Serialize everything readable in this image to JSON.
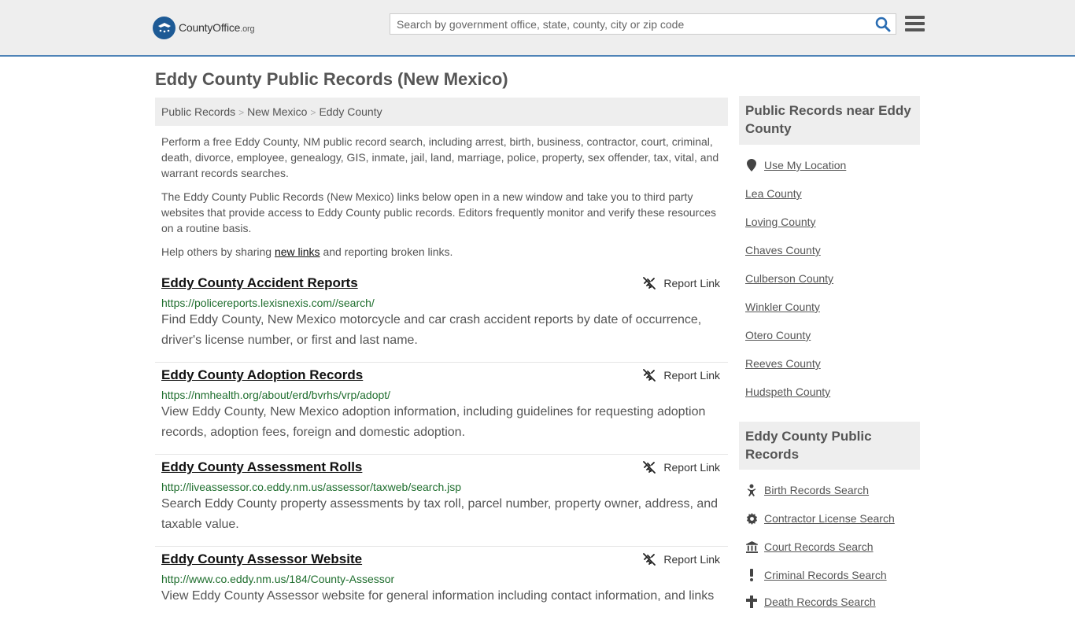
{
  "header": {
    "logo_main": "CountyOffice",
    "logo_org": ".org",
    "search_placeholder": "Search by government office, state, county, city or zip code"
  },
  "page_title": "Eddy County Public Records (New Mexico)",
  "breadcrumb": [
    "Public Records",
    "New Mexico",
    "Eddy County"
  ],
  "intro": {
    "p1": "Perform a free Eddy County, NM public record search, including arrest, birth, business, contractor, court, criminal, death, divorce, employee, genealogy, GIS, inmate, jail, land, marriage, police, property, sex offender, tax, vital, and warrant records searches.",
    "p2": "The Eddy County Public Records (New Mexico) links below open in a new window and take you to third party websites that provide access to Eddy County public records. Editors frequently monitor and verify these resources on a routine basis.",
    "p3_before": "Help others by sharing ",
    "p3_link": "new links",
    "p3_after": " and reporting broken links."
  },
  "report_label": "Report Link",
  "records": [
    {
      "title": "Eddy County Accident Reports",
      "url": "https://policereports.lexisnexis.com//search/",
      "desc": "Find Eddy County, New Mexico motorcycle and car crash accident reports by date of occurrence, driver's license number, or first and last name."
    },
    {
      "title": "Eddy County Adoption Records",
      "url": "https://nmhealth.org/about/erd/bvrhs/vrp/adopt/",
      "desc": "View Eddy County, New Mexico adoption information, including guidelines for requesting adoption records, adoption fees, foreign and domestic adoption."
    },
    {
      "title": "Eddy County Assessment Rolls",
      "url": "http://liveassessor.co.eddy.nm.us/assessor/taxweb/search.jsp",
      "desc": "Search Eddy County property assessments by tax roll, parcel number, property owner, address, and taxable value."
    },
    {
      "title": "Eddy County Assessor Website",
      "url": "http://www.co.eddy.nm.us/184/County-Assessor",
      "desc": "View Eddy County Assessor website for general information including contact information, and links"
    }
  ],
  "sidebar": {
    "nearby_heading": "Public Records near Eddy County",
    "use_location": "Use My Location",
    "nearby": [
      "Lea County",
      "Loving County",
      "Chaves County",
      "Culberson County",
      "Winkler County",
      "Otero County",
      "Reeves County",
      "Hudspeth County"
    ],
    "records_heading": "Eddy County Public Records",
    "record_links": [
      {
        "label": "Birth Records Search",
        "icon": "baby-icon"
      },
      {
        "label": "Contractor License Search",
        "icon": "gear-icon"
      },
      {
        "label": "Court Records Search",
        "icon": "courthouse-icon"
      },
      {
        "label": "Criminal Records Search",
        "icon": "exclamation-icon"
      },
      {
        "label": "Death Records Search",
        "icon": "cross-icon"
      }
    ]
  },
  "colors": {
    "header_bg": "#eeeeee",
    "header_border": "#4f83b7",
    "logo_blue": "#1d5a95",
    "search_icon": "#2a6db3",
    "url_green": "#1f6e2e"
  }
}
